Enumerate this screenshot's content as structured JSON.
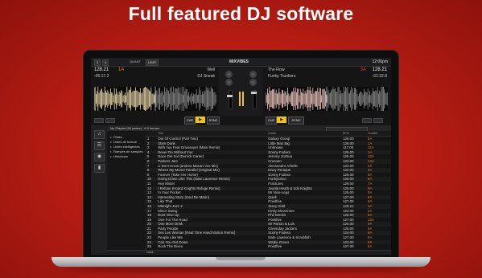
{
  "headline": "Full featured DJ software",
  "app": {
    "topbar": {
      "deck_left_num": "2",
      "deck_right_num": "4",
      "quant_label": "QUANT",
      "limit_label": "LIMIT",
      "brand": "MIXVIBES",
      "clock": "12:06pm"
    },
    "deck_left": {
      "bpm": "128.21",
      "key": "1A",
      "time": "-05:17.2",
      "title": "Well",
      "artist": "DJ Sneak",
      "cue_label": "CUE",
      "play_icon": "play-icon",
      "sync_label": "SYNC",
      "wave_color": "#e8d8a8"
    },
    "deck_right": {
      "bpm": "128.21",
      "key": "3A",
      "time": "-01:32.8",
      "title": "The Flow",
      "artist": "Funky Trunkers",
      "cue_label": "CUE",
      "play_icon": "play-icon",
      "sync_label": "SYNC",
      "wave_color": "#f0c8c0"
    },
    "browser": {
      "playlist_header": "My Playlist (65 pistes) : 6.9 heures",
      "search_placeholder": "",
      "folders": [
        {
          "label": "Pistes"
        },
        {
          "label": "Listes de lecture"
        },
        {
          "label": "Listes intelligentes"
        },
        {
          "label": "Rampes de samples"
        },
        {
          "label": "Historique"
        }
      ],
      "columns": [
        "",
        "Titre",
        "Artiste",
        "BPM",
        "Tonalité"
      ],
      "rows": [
        {
          "n": "1",
          "title": "Out Of Control (Part Two)",
          "artist": "Galaxy Group",
          "bpm": "126.00",
          "key": "5A"
        },
        {
          "n": "2",
          "title": "Slam Dunk",
          "artist": "Little Man Big",
          "bpm": "126.00",
          "key": "1A"
        },
        {
          "n": "3",
          "title": "With You Feat Grivoseyer (Main Remix)",
          "artist": "Unknown",
          "bpm": "117.00",
          "key": "11A"
        },
        {
          "n": "4",
          "title": "Never Do Without You",
          "artist": "Sonny Fodera",
          "bpm": "125.00",
          "key": "1A"
        },
        {
          "n": "5",
          "title": "Nace Del Sol (Derrick Carter)",
          "artist": "Jeremy Joshua",
          "bpm": "126.00",
          "key": "12A"
        },
        {
          "n": "6",
          "title": "Parkers Jam",
          "artist": "Crusoen",
          "bpm": "123.00",
          "key": "10A"
        },
        {
          "n": "7",
          "title": "U Dont Know (andrea Macari Vox Mix)",
          "artist": "Alessandro Arbelle",
          "bpm": "123.00",
          "key": "2A"
        },
        {
          "n": "8",
          "title": "Where My Monet Parallel (Original Mix)",
          "artist": "Dany Peraque",
          "bpm": "122.00",
          "key": "3A"
        },
        {
          "n": "9",
          "title": "Forever (Take Her Home)",
          "artist": "Sonny Fodera",
          "bpm": "125.00",
          "key": "8A"
        },
        {
          "n": "10",
          "title": "Going Down Like This (Nate Laurence Remix)",
          "artist": "Funkytosco",
          "bpm": "125.00",
          "key": "8A"
        },
        {
          "n": "11",
          "title": "Hey Mister",
          "artist": "Fractures",
          "bpm": "126.00",
          "key": "7A"
        },
        {
          "n": "12",
          "title": "I Refuse (Hoard Knights Refuge Remix)",
          "artist": "Jeudia Heath & Irds Knights",
          "bpm": "125.00",
          "key": "8A"
        },
        {
          "n": "13",
          "title": "In Your Pocket",
          "artist": "Mr Nice-Legs",
          "bpm": "126.00",
          "key": "8A"
        },
        {
          "n": "14",
          "title": "Interesting Story (Soul De Marin)",
          "artist": "Quell",
          "bpm": "127.00",
          "key": "8A"
        },
        {
          "n": "15",
          "title": "Like That",
          "artist": "Pointfive",
          "bpm": "127.00",
          "key": "6A"
        },
        {
          "n": "16",
          "title": "Midnight Jazz 2",
          "artist": "Stacy Kidd",
          "bpm": "128.21",
          "key": "3A"
        },
        {
          "n": "17",
          "title": "Minor Swing",
          "artist": "Kinky Movement",
          "bpm": "123.00",
          "key": "2A"
        },
        {
          "n": "18",
          "title": "Dont Give Up",
          "artist": "Phil Weeks",
          "bpm": "125.00",
          "key": "8A"
        },
        {
          "n": "19",
          "title": "One For The Road",
          "artist": "Pointfive",
          "bpm": "127.00",
          "key": "10A"
        },
        {
          "n": "20",
          "title": "One More Drink",
          "artist": "Mr Parton & Luis",
          "bpm": "124.00",
          "key": "9A"
        },
        {
          "n": "21",
          "title": "Party People",
          "artist": "Greenday Jackers",
          "bpm": "125.00",
          "key": "9A"
        },
        {
          "n": "22",
          "title": "Sex Len Woman (Real Time Hand Motion Remix)",
          "artist": "Sonny Fodera",
          "bpm": "124.00",
          "key": "8A"
        },
        {
          "n": "23",
          "title": "People Like We",
          "artist": "Nate Laurence & Scrubfish",
          "bpm": "127.00",
          "key": "8A"
        },
        {
          "n": "24",
          "title": "Can You Get Down",
          "artist": "Wattie Green",
          "bpm": "123.00",
          "key": "8A"
        },
        {
          "n": "25",
          "title": "Rock The Disco",
          "artist": "Pointfive",
          "bpm": "127.00",
          "key": "6A"
        }
      ],
      "bottom_brand": "cross"
    },
    "colors": {
      "accent_orange": "#f07a1a",
      "accent_red": "#e03030",
      "play_yellow": "#f1c40f"
    }
  }
}
